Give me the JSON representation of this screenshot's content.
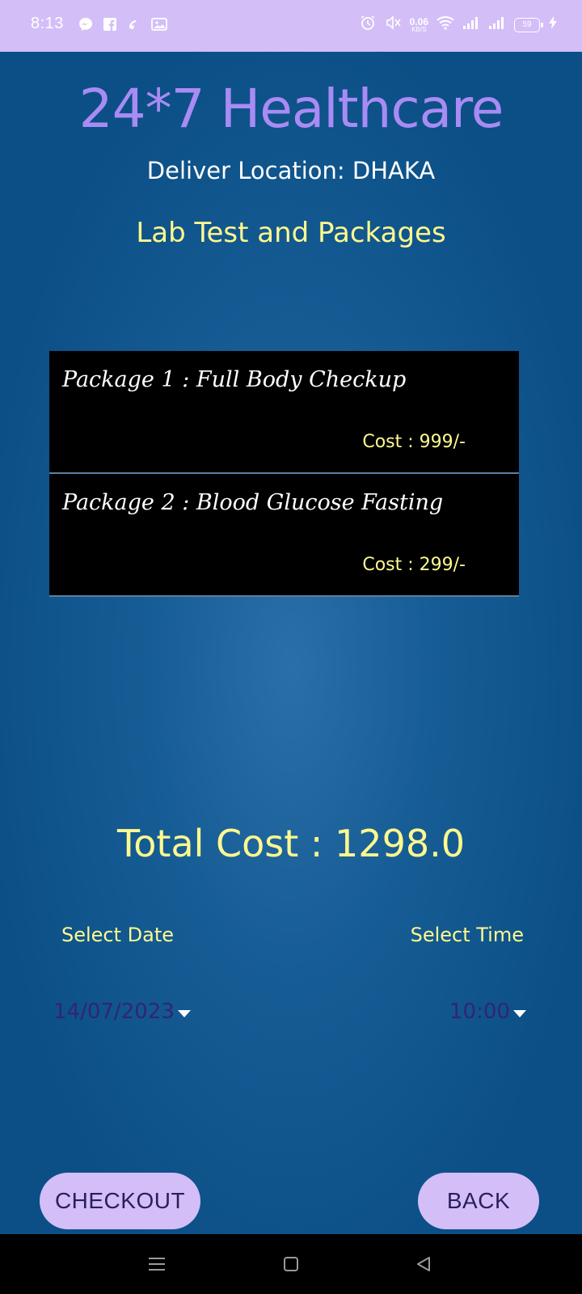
{
  "status_bar": {
    "time": "8:13",
    "net_speed": "0.06",
    "net_speed_unit": "KB/S",
    "battery": "59",
    "icons": [
      "messenger-icon",
      "facebook-icon",
      "link-app-icon",
      "photo-app-icon",
      "alarm-icon",
      "mute-icon",
      "wifi-icon",
      "signal-icon",
      "signal-icon",
      "battery-icon",
      "charging-icon"
    ]
  },
  "header": {
    "app_title": "24*7 Healthcare",
    "deliver_location": "Deliver Location: DHAKA",
    "section_title": "Lab Test and Packages"
  },
  "packages": [
    {
      "name": "Package 1 : Full Body Checkup",
      "cost": "Cost : 999/-"
    },
    {
      "name": "Package 2 : Blood Glucose Fasting",
      "cost": "Cost : 299/-"
    }
  ],
  "total_cost": "Total Cost : 1298.0",
  "selectors": {
    "date_label": "Select Date",
    "time_label": "Select Time",
    "date_value": "14/07/2023",
    "time_value": "10:00"
  },
  "buttons": {
    "checkout": "CHECKOUT",
    "back": "BACK"
  },
  "colors": {
    "accent_lavender": "#d3bef8",
    "title_purple": "#a98bf4",
    "highlight_yellow": "#fff98e",
    "background_blue": "#0b4f86"
  }
}
